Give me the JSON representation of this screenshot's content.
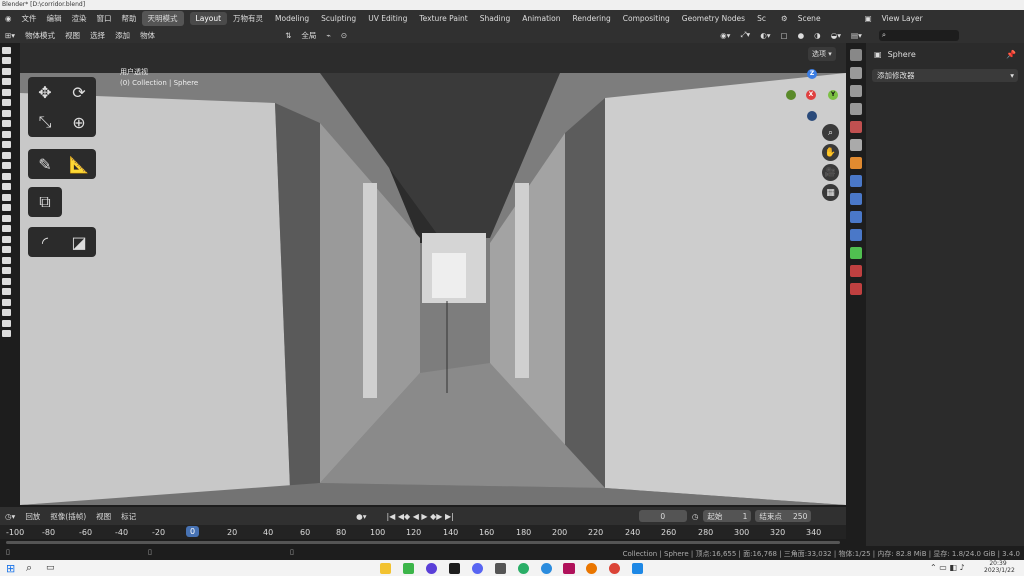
{
  "titlebar": {
    "title": "Blender* [D:\\corridor.blend]"
  },
  "menu": {
    "items": [
      "文件",
      "编辑",
      "渲染",
      "窗口",
      "帮助"
    ],
    "mode_btn": "天明模式"
  },
  "workspaces": [
    "Layout",
    "万物有灵",
    "Modeling",
    "Sculpting",
    "UV Editing",
    "Texture Paint",
    "Shading",
    "Animation",
    "Rendering",
    "Compositing",
    "Geometry Nodes",
    "Sc"
  ],
  "scene": {
    "label": "Scene"
  },
  "view_layer": {
    "label": "View Layer"
  },
  "viewport_header": {
    "mode": "物体模式",
    "menus": [
      "视图",
      "选择",
      "添加",
      "物体"
    ],
    "transform": "全局"
  },
  "viewport": {
    "overlay_line1": "用户透视",
    "overlay_line2": "(0) Collection | Sphere",
    "options": "选项"
  },
  "gizmo": {
    "z": "Z",
    "x": "X",
    "y": "Y"
  },
  "properties": {
    "object": "Sphere",
    "add_modifier": "添加修改器"
  },
  "timeline": {
    "menus": [
      "回放",
      "抠像(插帧)",
      "视图",
      "标记"
    ],
    "current_frame": "0",
    "start_label": "起始",
    "start": "1",
    "end_label": "结束点",
    "end": "250"
  },
  "ruler": {
    "ticks": [
      "-100",
      "-80",
      "-60",
      "-40",
      "-20",
      "0",
      "20",
      "40",
      "60",
      "80",
      "100",
      "120",
      "140",
      "160",
      "180",
      "200",
      "220",
      "240",
      "260",
      "280",
      "300",
      "320",
      "340"
    ]
  },
  "status": {
    "text": "Collection | Sphere | 顶点:16,655 | 面:16,768 | 三角面:33,032 | 物体:1/25 | 内存: 82.8 MiB | 显存: 1.8/24.0 GiB | 3.4.0"
  },
  "taskbar": {
    "time": "20:39",
    "date": "2023/1/22"
  }
}
